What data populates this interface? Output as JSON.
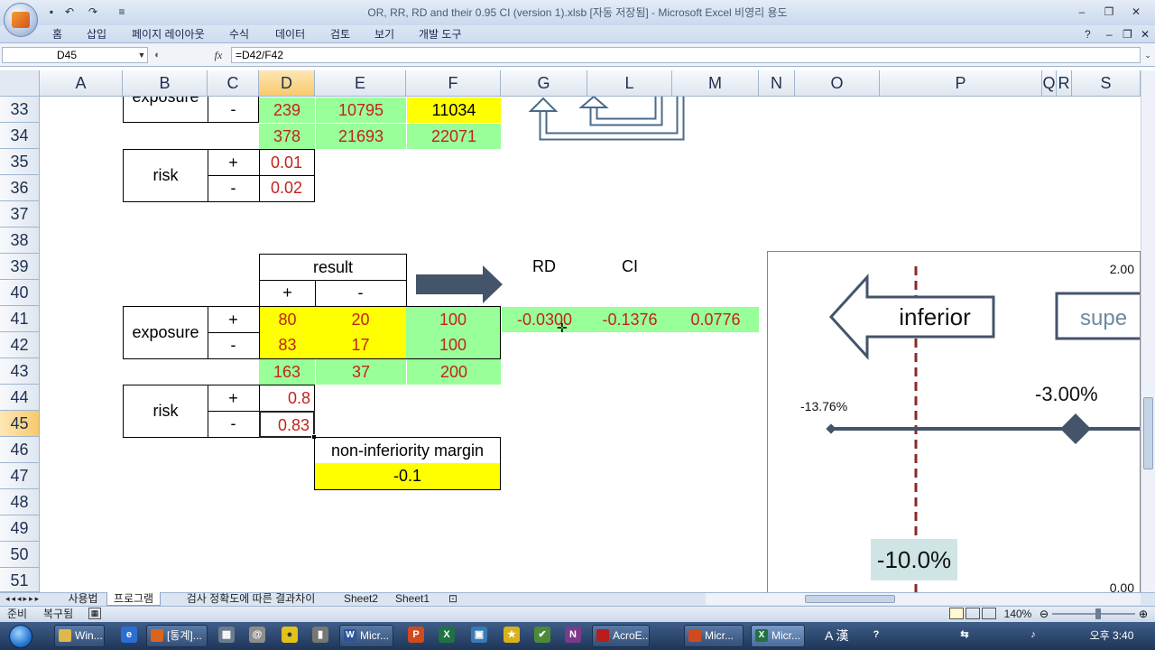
{
  "window": {
    "title": "OR, RR, RD and their 0.95 CI (version 1).xlsb [자동 저장됨] - Microsoft Excel 비영리 용도"
  },
  "ribbon_tabs": [
    "홈",
    "삽입",
    "페이지 레이아웃",
    "수식",
    "데이터",
    "검토",
    "보기",
    "개발 도구"
  ],
  "formula_bar": {
    "name_box": "D45",
    "fx": "fx",
    "formula": "=D42/F42"
  },
  "columns": [
    "A",
    "B",
    "C",
    "D",
    "E",
    "F",
    "G",
    "L",
    "M",
    "N",
    "O",
    "P",
    "Q",
    "R",
    "S"
  ],
  "rows": [
    "33",
    "34",
    "35",
    "36",
    "37",
    "38",
    "39",
    "40",
    "41",
    "42",
    "43",
    "44",
    "45",
    "46",
    "47",
    "48",
    "49",
    "50",
    "51"
  ],
  "selected_cell": {
    "column": "D",
    "row": "45"
  },
  "cells": {
    "b33": "exposure",
    "c33": "-",
    "d33": "239",
    "e33": "10795",
    "f33": "11034",
    "d34": "378",
    "e34": "21693",
    "f34": "22071",
    "b35": "risk",
    "c35": "+",
    "d35": "0.01",
    "c36": "-",
    "d36": "0.02",
    "d39": "result",
    "g39": "RD",
    "l39": "CI",
    "d40": "+",
    "e40": "-",
    "b41": "exposure",
    "c41": "+",
    "d41": "80",
    "e41": "20",
    "f41": "100",
    "g41": "-0.0300",
    "l41": "-0.1376",
    "m41": "0.0776",
    "c42": "-",
    "d42": "83",
    "e42": "17",
    "f42": "100",
    "d43": "163",
    "e43": "37",
    "f43": "200",
    "b44": "risk",
    "c44": "+",
    "d44": "0.8",
    "c45": "-",
    "d45": "0.83",
    "e46": "non-inferiority margin",
    "e47": "-0.1"
  },
  "chart": {
    "inferior_label": "inferior",
    "superior_label": "supe",
    "ci_lower_label": "-13.76%",
    "point_label": "-3.00%",
    "margin_label": "-10.0%",
    "y_top": "2.00",
    "y_bottom": "0.00",
    "ci_lower": -0.1376,
    "rd": -0.03,
    "margin": -0.1
  },
  "sheet_tabs": [
    "사용법",
    "프로그램",
    "검사 정확도에 따른 결과차이",
    "Sheet2",
    "Sheet1"
  ],
  "active_sheet": "프로그램",
  "status": {
    "ready": "준비",
    "recovered": "복구됨",
    "zoom": "140%"
  },
  "taskbar": {
    "buttons": [
      "Win...",
      "[통계]...",
      "Micr...",
      "AcroE...",
      "Micr...",
      "Micr..."
    ],
    "tray_time": "오후 3:40",
    "ime": "A 漢"
  },
  "colors": {
    "accent_selected": "#f8c96b",
    "yellow": "#ffff00",
    "green": "#99ff99",
    "value_red": "#c0241b",
    "arrow_navy": "#44546a",
    "arrow_outline": "#4a6b8a"
  }
}
